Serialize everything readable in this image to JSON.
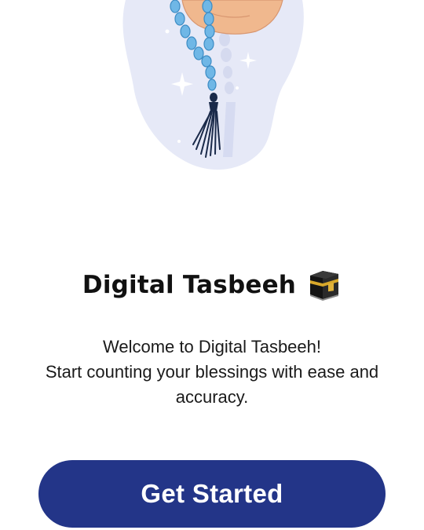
{
  "hero": {
    "illustration": "hand-holding-tasbeeh-beads-illustration",
    "blob_color": "#e6e9f7",
    "bead_color": "#6fb7e6",
    "tassel_color": "#1a2a4a"
  },
  "onboarding": {
    "title": "Digital Tasbeeh",
    "title_icon": "kaaba-icon",
    "subtitle_line1": "Welcome to Digital Tasbeeh!",
    "subtitle_line2": "Start counting your blessings with ease and accuracy."
  },
  "cta": {
    "label": "Get Started",
    "color": "#233588"
  }
}
